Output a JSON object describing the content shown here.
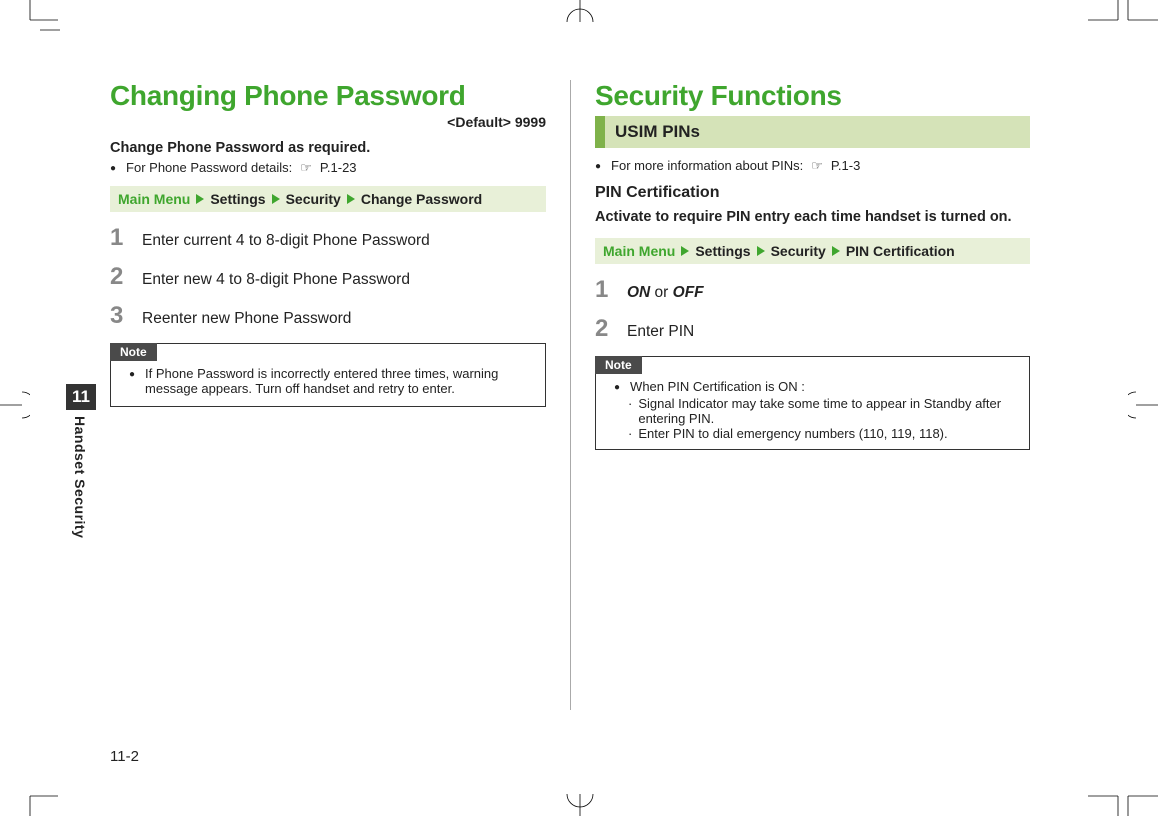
{
  "side": {
    "chapter_num": "11",
    "chapter_label": "Handset Security"
  },
  "page_number": "11-2",
  "left": {
    "title": "Changing Phone Password",
    "default": "<Default> 9999",
    "intro": "Change Phone Password as required.",
    "detail_prefix": "For Phone Password details: ",
    "detail_ref": "P.1-23",
    "nav": [
      "Main Menu",
      "Settings",
      "Security",
      "Change Password"
    ],
    "steps": [
      "Enter current 4 to 8-digit Phone Password",
      "Enter new 4 to 8-digit Phone Password",
      "Reenter new Phone Password"
    ],
    "note_label": "Note",
    "note_text": "If Phone Password is incorrectly entered three times, warning message appears. Turn off handset and retry to enter."
  },
  "right": {
    "title": "Security Functions",
    "section": "USIM PINs",
    "info_prefix": "For more information about PINs: ",
    "info_ref": "P.1-3",
    "subhead": "PIN Certification",
    "intro": "Activate to require PIN entry each time handset is turned on.",
    "nav": [
      "Main Menu",
      "Settings",
      "Security",
      "PIN Certification"
    ],
    "step1_on": "ON",
    "step1_or": " or ",
    "step1_off": "OFF",
    "step2": "Enter PIN",
    "note_label": "Note",
    "note_lead": "When PIN Certification is ON :",
    "note_sub1": "Signal Indicator may take some time to appear in Standby after entering PIN.",
    "note_sub2": "Enter PIN to dial emergency numbers (110, 119, 118)."
  }
}
